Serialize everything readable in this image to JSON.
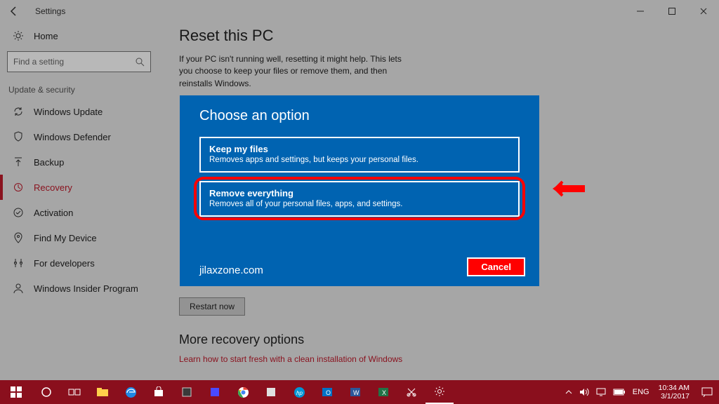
{
  "window": {
    "title": "Settings"
  },
  "sidebar": {
    "home": "Home",
    "search_placeholder": "Find a setting",
    "section": "Update & security",
    "items": [
      {
        "label": "Windows Update"
      },
      {
        "label": "Windows Defender"
      },
      {
        "label": "Backup"
      },
      {
        "label": "Recovery"
      },
      {
        "label": "Activation"
      },
      {
        "label": "Find My Device"
      },
      {
        "label": "For developers"
      },
      {
        "label": "Windows Insider Program"
      }
    ]
  },
  "main": {
    "heading": "Reset this PC",
    "description": "If your PC isn't running well, resetting it might help. This lets you choose to keep your files or remove them, and then reinstalls Windows.",
    "restart_label": "Restart now",
    "more_heading": "More recovery options",
    "more_link": "Learn how to start fresh with a clean installation of Windows"
  },
  "modal": {
    "title": "Choose an option",
    "options": [
      {
        "title": "Keep my files",
        "desc": "Removes apps and settings, but keeps your personal files."
      },
      {
        "title": "Remove everything",
        "desc": "Removes all of your personal files, apps, and settings."
      }
    ],
    "cancel": "Cancel",
    "watermark": "jilaxzone.com"
  },
  "taskbar": {
    "lang": "ENG",
    "time": "10:34 AM",
    "date": "3/1/2017"
  }
}
